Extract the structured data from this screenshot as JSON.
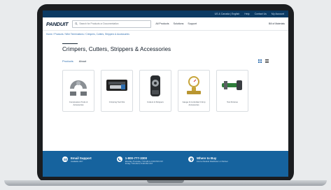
{
  "utility_bar": {
    "region": "US & Canada | English",
    "help": "Help",
    "contact_us": "Contact Us",
    "my_account": "My Account"
  },
  "header": {
    "logo": "PANDUIT",
    "search_placeholder": "Search for Products or Documentation",
    "nav": [
      "All Products",
      "Solutions",
      "Support"
    ],
    "bom": "Bill of Materials"
  },
  "breadcrumb": "Home / Products / Wire Terminations / Crimpers, Cutters, Strippers & Accessories",
  "page_title": "Crimpers, Cutters, Strippers & Accessories",
  "tabs": [
    "Products",
    "About"
  ],
  "cards": [
    {
      "label": "Compression Tools & Accessories"
    },
    {
      "label": "Crimping Tool Kits"
    },
    {
      "label": "Cutters & Strippers"
    },
    {
      "label": "Gauge & Controlled Crimp Accessories"
    },
    {
      "label": "Tool Fixtures"
    }
  ],
  "footer": {
    "email": {
      "title": "Email Support",
      "sub": "Available 24/7"
    },
    "phone": {
      "title": "1-800-777-3300",
      "sub": "Monday-Thursday 7:00 AM to 6:00 PM CST\nFriday 7:00 AM to 5:00 PM CST"
    },
    "where": {
      "title": "Where to Buy",
      "sub": "Find a Panduit Distributor or Partner"
    }
  },
  "colors": {
    "utility_bar": "#0b3a63",
    "footer": "#16639e",
    "accent": "#2f6fb0"
  }
}
